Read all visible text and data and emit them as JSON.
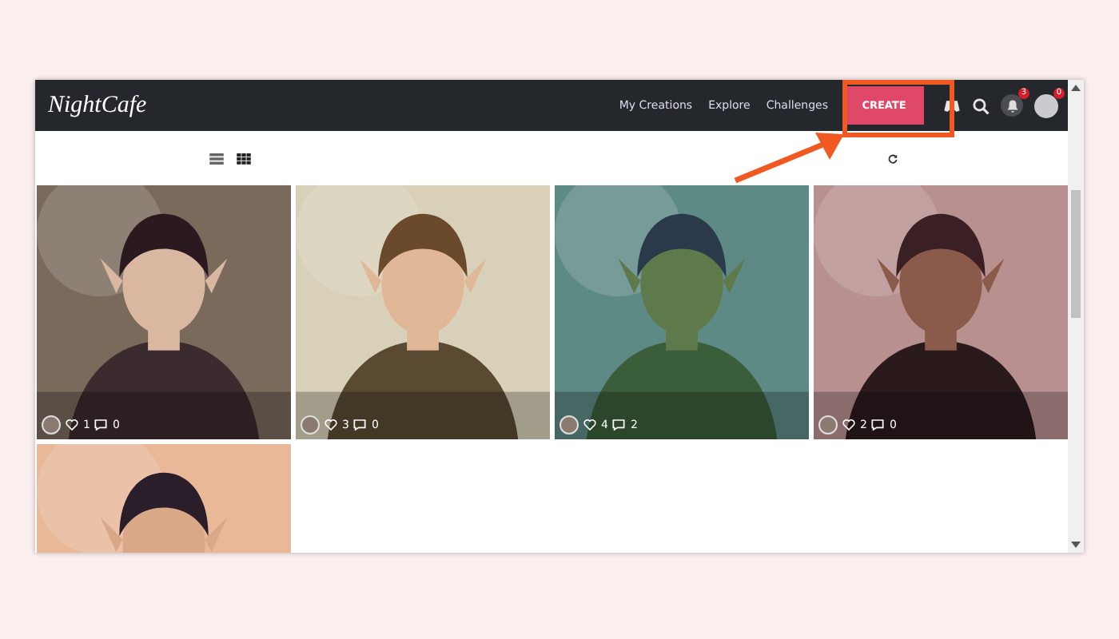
{
  "header": {
    "logo": "NightCafe",
    "nav": [
      "My Creations",
      "Explore",
      "Challenges"
    ],
    "create_button": "CREATE",
    "notifications_badge": "3",
    "profile_badge": "0"
  },
  "view_toggles": [
    {
      "kind": "list",
      "selected": false
    },
    {
      "kind": "grid",
      "selected": true
    }
  ],
  "tiles": [
    {
      "kind": "picture",
      "likes": "1",
      "comments": "0"
    },
    {
      "kind": "picture",
      "likes": "3",
      "comments": "0"
    },
    {
      "kind": "picture",
      "likes": "4",
      "comments": "2"
    },
    {
      "kind": "picture",
      "likes": "2",
      "comments": "0"
    },
    {
      "kind": "picture"
    }
  ]
}
